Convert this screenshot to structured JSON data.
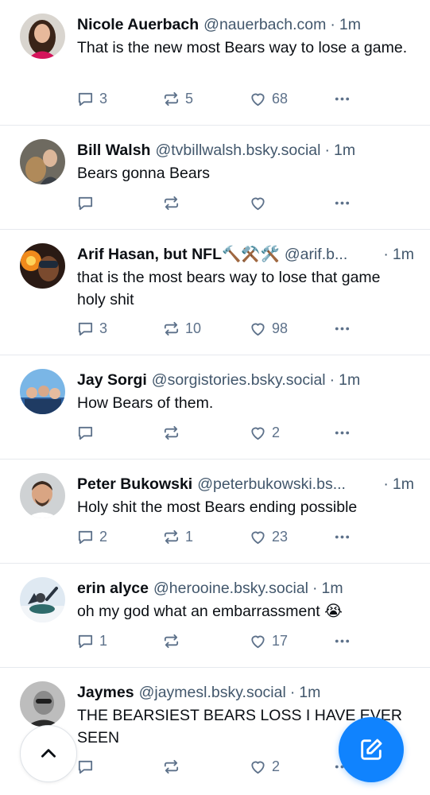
{
  "posts": [
    {
      "name": "Nicole Auerbach",
      "handle": "@nauerbach.com",
      "dot": "·",
      "time": "1m",
      "text": "That is the new most Bears way to lose a game.",
      "replies": "3",
      "reposts": "5",
      "likes": "68"
    },
    {
      "name": "Bill Walsh",
      "handle": "@tvbillwalsh.bsky.social",
      "dot": "·",
      "time": "1m",
      "text": "Bears gonna Bears",
      "replies": "",
      "reposts": "",
      "likes": ""
    },
    {
      "name": "Arif Hasan, but NFL🔨⚒️🛠️",
      "handle": "@arif.b...",
      "dot": "·",
      "time": "1m",
      "text": "that is the most bears way to lose that game holy shit",
      "replies": "3",
      "reposts": "10",
      "likes": "98"
    },
    {
      "name": "Jay Sorgi",
      "handle": "@sorgistories.bsky.social",
      "dot": "·",
      "time": "1m",
      "text": "How Bears of them.",
      "replies": "",
      "reposts": "",
      "likes": "2"
    },
    {
      "name": "Peter Bukowski",
      "handle": "@peterbukowski.bs...",
      "dot": "·",
      "time": "1m",
      "text": "Holy shit the most Bears ending possible",
      "replies": "2",
      "reposts": "1",
      "likes": "23"
    },
    {
      "name": "erin alyce",
      "handle": "@herooine.bsky.social",
      "dot": "·",
      "time": "1m",
      "text": "oh my god what an embarrassment 😭",
      "replies": "1",
      "reposts": "",
      "likes": "17"
    },
    {
      "name": "Jaymes",
      "handle": "@jaymesl.bsky.social",
      "dot": "·",
      "time": "1m",
      "text": "THE BEARSIEST BEARS LOSS I HAVE EVER SEEN",
      "replies": "",
      "reposts": "",
      "likes": "2"
    }
  ],
  "icons": {
    "reply": "reply-icon",
    "repost": "repost-icon",
    "like": "heart-icon",
    "more": "more-icon",
    "scroll_top": "chevron-up-icon",
    "compose": "compose-icon"
  },
  "colors": {
    "accent": "#1083fe",
    "muted": "#42576c",
    "action": "#5d718a"
  }
}
